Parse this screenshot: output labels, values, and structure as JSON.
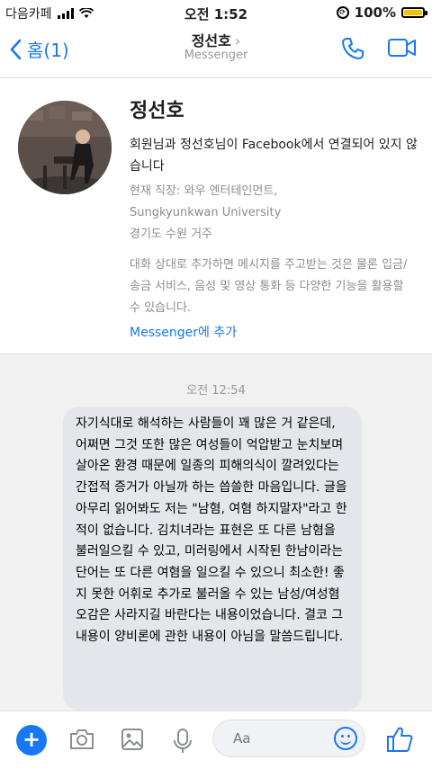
{
  "status_bar": {
    "carrier": "다음카페",
    "time": "오전 1:52",
    "battery_pct": "100%",
    "battery_level": 1.0
  },
  "nav": {
    "back_label": "홈(1)",
    "title": "정선호",
    "subtitle": "Messenger",
    "icons": [
      "phone-icon",
      "video-camera-icon"
    ]
  },
  "profile": {
    "name": "정선호",
    "not_connected": "회원님과 정선호님이 Facebook에서 연결되어 있지 않습니다",
    "workplace_line1": "현재 직장: 와우 엔터테인먼트,",
    "workplace_line2": "Sungkyunkwan University",
    "location": "경기도 수원 거주",
    "note": "대화 상대로 추가하면 메시지를 주고받는 것은 물론 입금/송금 서비스, 음성 및 영상 통화 등 다양한 기능을 활용할 수 있습니다.",
    "add_link": "Messenger에 추가"
  },
  "chat": {
    "timestamp": "오전 12:54",
    "message": "자기식대로 해석하는 사람들이 꽤 많은 거 같은데, 어쩌면 그것 또한 많은 여성들이 억압받고 눈치보며 살아온 환경 때문에 일종의 피해의식이 깔려있다는 간접적 증거가 아닐까 하는 씁쓸한 마음입니다. 글을 아무리 읽어봐도 저는 \"남혐, 여혐 하지말자\"라고 한 적이 없습니다. 김치녀라는 표현은 또 다른 남혐을 불러일으킬 수 있고, 미러링에서 시작된 한남이라는 단어는 또 다른 여혐을 일으킬 수 있으니 최소한! 좋지 못한 어휘로 추가로 불러올 수 있는 남성/여성혐오감은 사라지길 바란다는 내용이었습니다. 결코 그 내용이 양비론에 관한 내용이 아님을 말씀드립니다."
  },
  "composer": {
    "placeholder": "Aa",
    "icons": [
      "plus-icon",
      "camera-icon",
      "image-icon",
      "microphone-icon",
      "emoji-icon",
      "thumbs-up-icon"
    ]
  },
  "colors": {
    "accent": "#1877f2",
    "bubble": "#e4e6eb",
    "battery": "#f5c000"
  }
}
